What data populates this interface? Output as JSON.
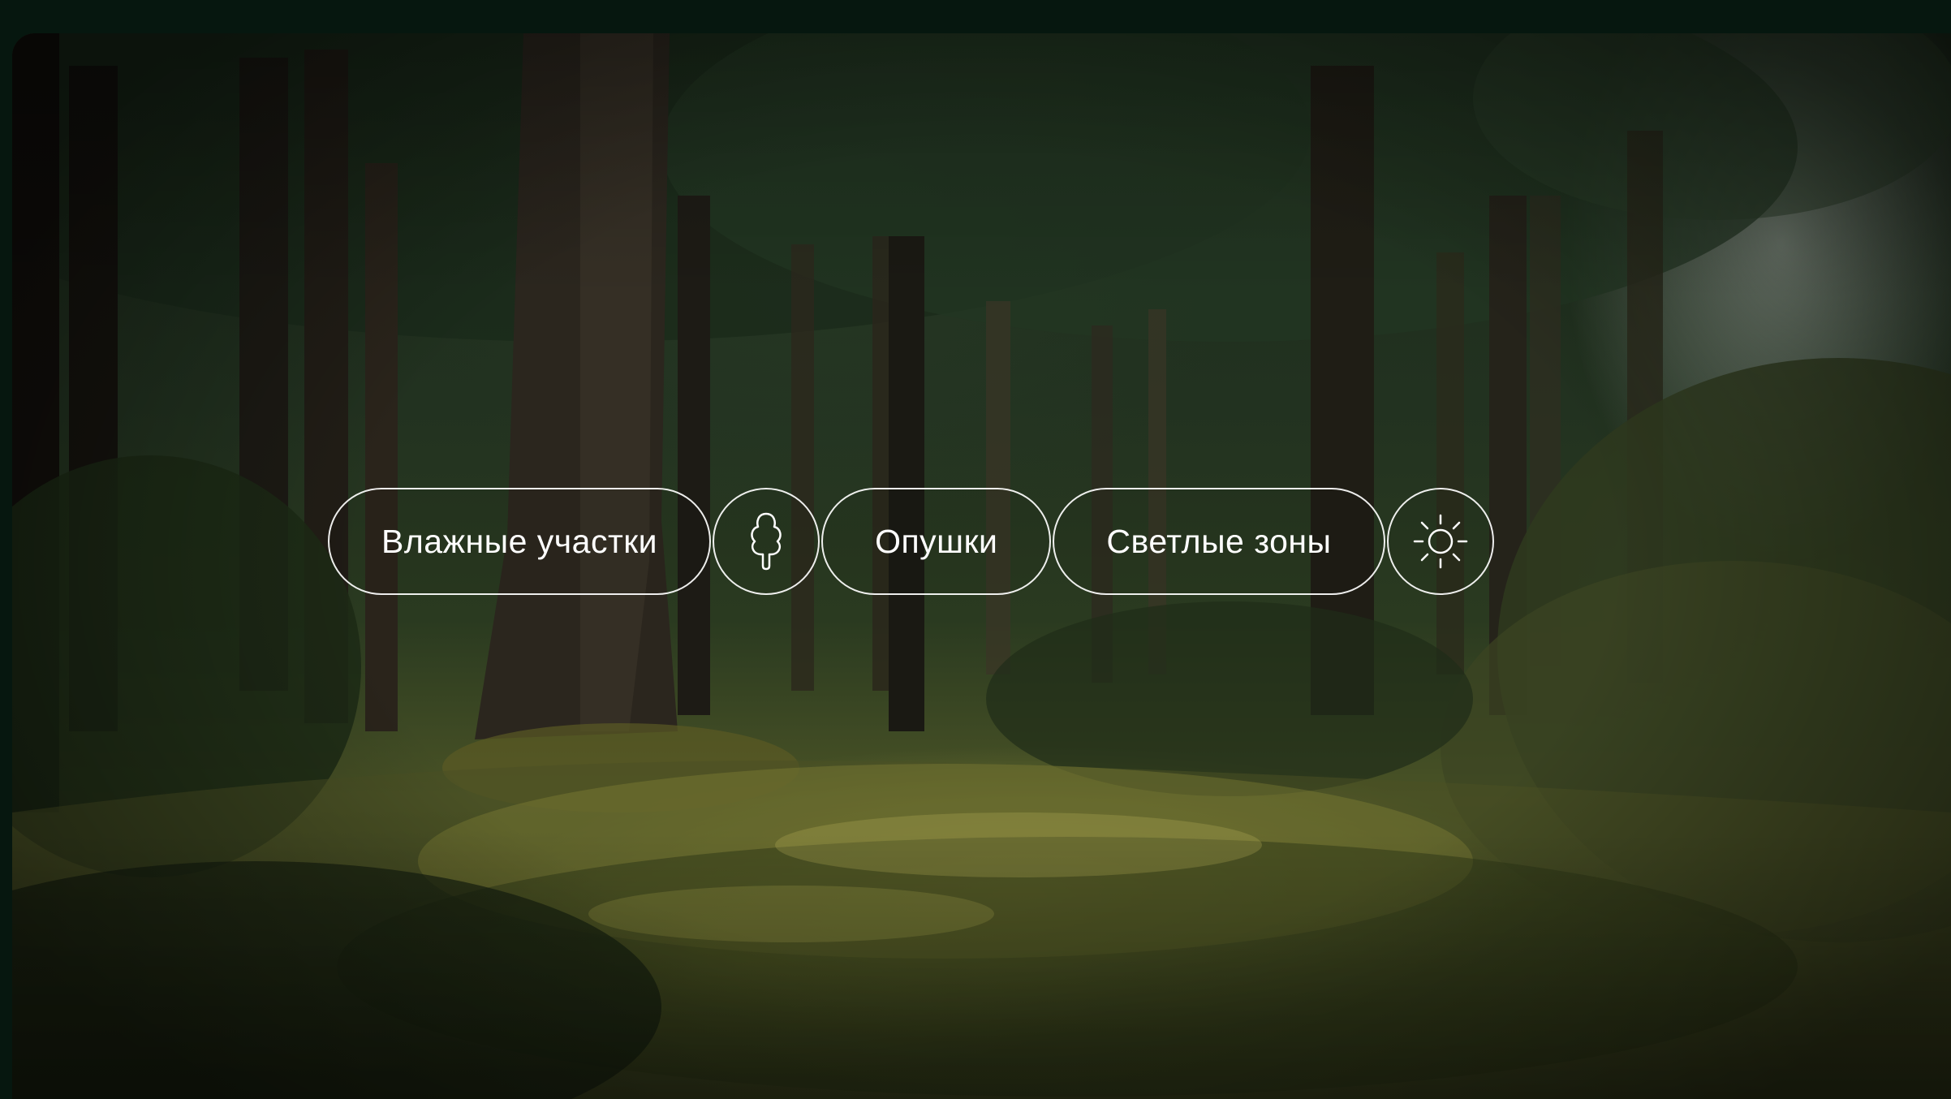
{
  "filters": {
    "wet_areas_label": "Влажные участки",
    "edges_label": "Опушки",
    "light_zones_label": "Светлые зоны"
  },
  "icons": {
    "tree": "tree-icon",
    "sun": "sun-icon"
  },
  "colors": {
    "page_background": "#06170f",
    "chip_border": "#ffffff",
    "chip_text": "#ffffff"
  }
}
